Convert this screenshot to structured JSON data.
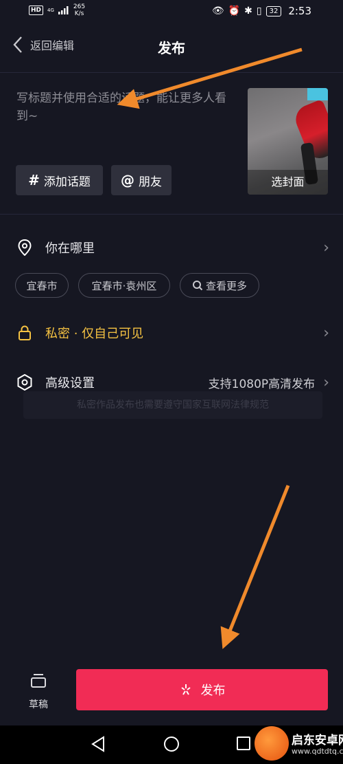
{
  "status_bar": {
    "hd": "HD",
    "network": "4G",
    "speed_value": "265",
    "speed_unit": "K/s",
    "battery": "32",
    "time": "2:53"
  },
  "header": {
    "back_label": "返回编辑",
    "title": "发布"
  },
  "caption": {
    "placeholder": "写标题并使用合适的话题，能让更多人看到~"
  },
  "cover": {
    "label": "选封面"
  },
  "tags": {
    "topic_label": "添加话题",
    "friends_label": "朋友"
  },
  "location": {
    "label": "你在哪里",
    "chips": [
      "宜春市",
      "宜春市·袁州区",
      "查看更多"
    ]
  },
  "privacy": {
    "label": "私密 · 仅自己可见",
    "color": "#f5c242"
  },
  "advanced": {
    "label": "高级设置",
    "value": "支持1080P高清发布"
  },
  "notice": {
    "text": "私密作品发布也需要遵守国家互联网法律规范"
  },
  "bottom": {
    "drafts_label": "草稿",
    "publish_label": "发布",
    "publish_color": "#f12c55"
  },
  "watermark": {
    "title": "启东安卓网",
    "url": "www.qdtdtq.com"
  },
  "annotations": {
    "arrow_color": "#f08a2c"
  }
}
